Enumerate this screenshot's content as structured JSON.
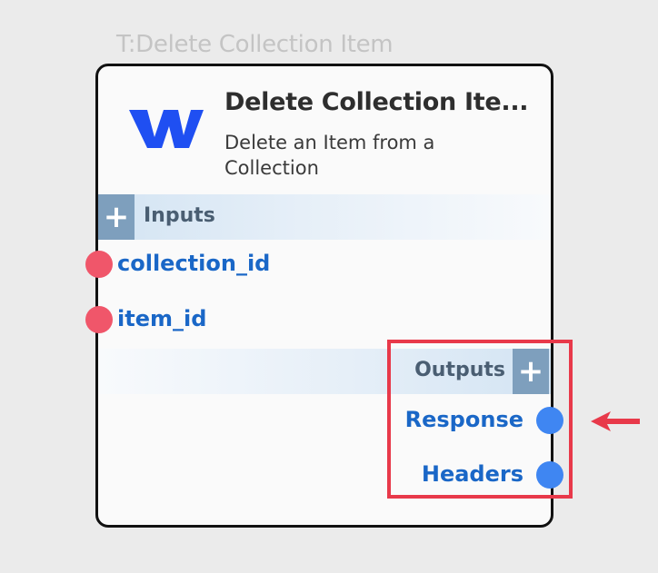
{
  "canvas": {
    "node_caption": "T:Delete Collection Item"
  },
  "node": {
    "title": "Delete Collection Ite...",
    "description": "Delete an Item from a Collection",
    "logo_icon": "webflow-logo-icon",
    "inputs": {
      "label": "Inputs",
      "add_symbol": "+",
      "ports": [
        {
          "name": "collection_id"
        },
        {
          "name": "item_id"
        }
      ]
    },
    "outputs": {
      "label": "Outputs",
      "add_symbol": "+",
      "ports": [
        {
          "name": "Response"
        },
        {
          "name": "Headers"
        }
      ]
    }
  },
  "annotation": {
    "highlight_color": "#e8394a",
    "arrow_color": "#e8394a"
  },
  "colors": {
    "input_port": "#f0566a",
    "output_port": "#3f86f2",
    "port_label": "#1a67c7",
    "add_button": "#7e9fbd",
    "logo": "#1f4ff2"
  }
}
